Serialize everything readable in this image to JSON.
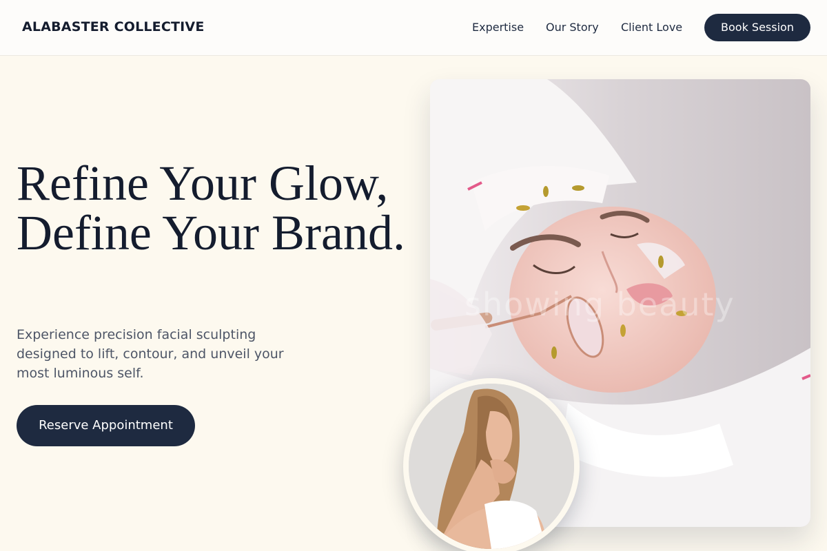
{
  "brand": "ALABASTER COLLECTIVE",
  "nav": {
    "items": [
      {
        "label": "Expertise"
      },
      {
        "label": "Our Story"
      },
      {
        "label": "Client Love"
      }
    ],
    "cta_label": "Book Session"
  },
  "hero": {
    "headline": "Refine Your Glow, Define Your Brand.",
    "subheadline": "Experience precision facial sculpting designed to lift, contour, and unveil your most luminous self.",
    "cta_label": "Reserve Appointment"
  },
  "images": {
    "main_watermark": "showing beauty"
  },
  "colors": {
    "background": "#fdf9ef",
    "primary": "#1e2a40",
    "header_bg": "#fdfcfa",
    "text_muted": "#4d5566"
  }
}
